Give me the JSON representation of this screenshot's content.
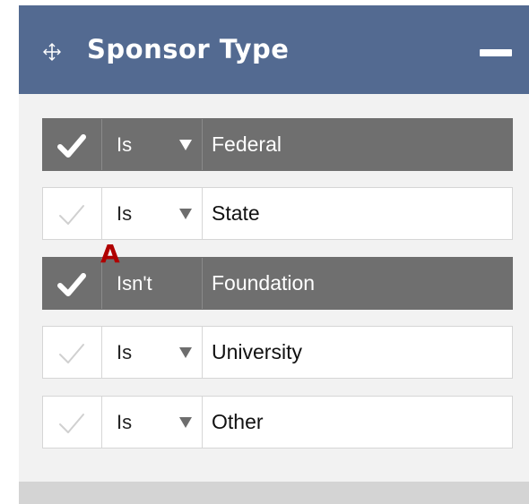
{
  "panel": {
    "title": "Sponsor Type",
    "move_icon": "move-cross-icon",
    "collapse_icon": "minus-icon",
    "header_color": "#536a91"
  },
  "annotation": {
    "marker": "A",
    "color": "#b00000"
  },
  "filters": [
    {
      "checked": true,
      "operator": "Is",
      "operator_has_dropdown": true,
      "value": "Federal"
    },
    {
      "checked": false,
      "operator": "Is",
      "operator_has_dropdown": true,
      "value": "State"
    },
    {
      "checked": true,
      "operator": "Isn't",
      "operator_has_dropdown": false,
      "value": "Foundation"
    },
    {
      "checked": false,
      "operator": "Is",
      "operator_has_dropdown": true,
      "value": "University"
    },
    {
      "checked": false,
      "operator": "Is",
      "operator_has_dropdown": true,
      "value": "Other"
    }
  ],
  "colors": {
    "active_row": "#6f6f6f",
    "inactive_check": "#d0d0d0"
  }
}
